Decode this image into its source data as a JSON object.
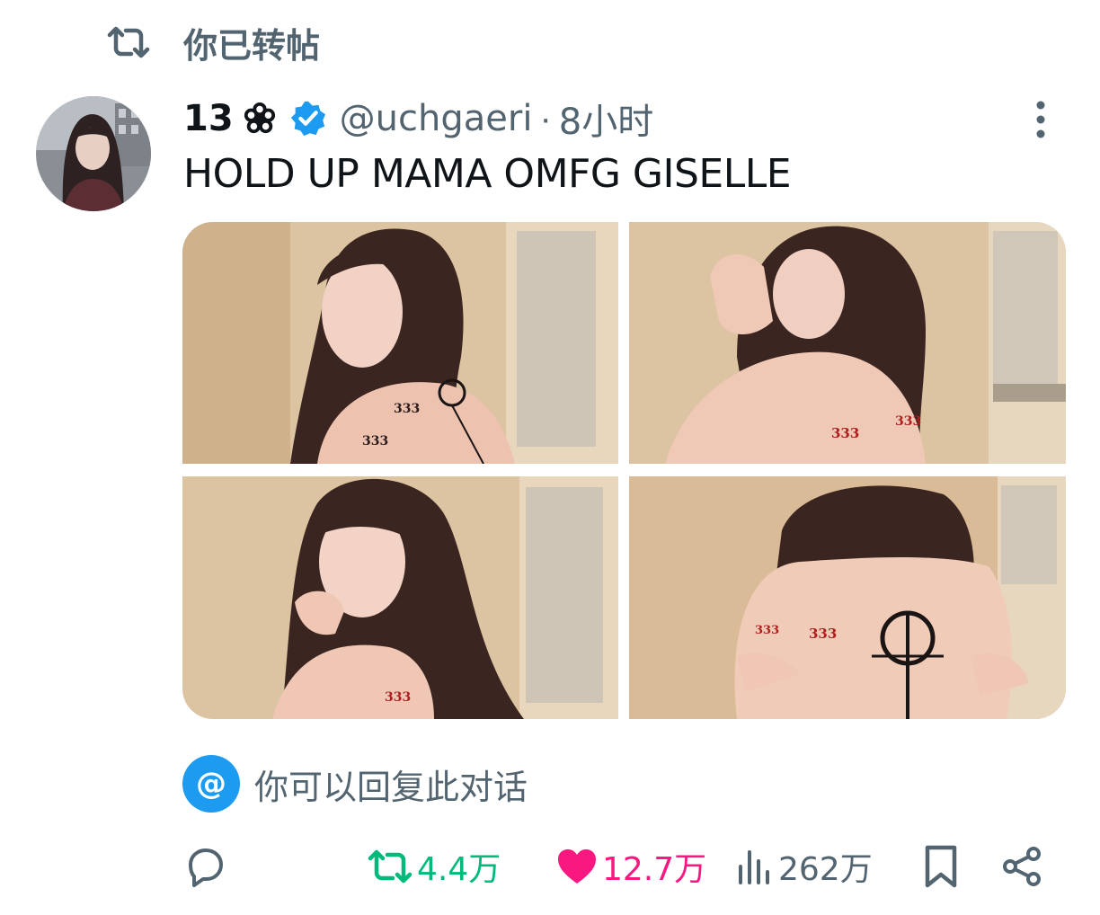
{
  "retweet_banner": {
    "text": "你已转帖",
    "icon": "retweet-icon"
  },
  "tweet": {
    "author": {
      "display_name": "13",
      "name_emoji": "flower-icon",
      "verified": true,
      "handle": "@uchgaeri"
    },
    "separator": "·",
    "time": "8小时",
    "text": "HOLD UP MAMA OMFG GISELLE",
    "media_count": 4,
    "photo_tattoo_text": "333"
  },
  "reply_restriction": {
    "badge": "@",
    "text": "你可以回复此对话"
  },
  "actions": {
    "reply": {
      "icon": "reply-icon"
    },
    "retweet": {
      "count": "4.4万",
      "icon": "retweet-icon",
      "active": true
    },
    "like": {
      "count": "12.7万",
      "icon": "heart-icon",
      "active": true
    },
    "views": {
      "count": "262万",
      "icon": "views-icon"
    },
    "bookmark": {
      "icon": "bookmark-icon"
    },
    "share": {
      "icon": "share-icon"
    }
  },
  "colors": {
    "accent": "#1d9bf0",
    "retweet_green": "#00ba7c",
    "like_pink": "#f91880",
    "muted": "#536471",
    "text": "#0f1419"
  }
}
